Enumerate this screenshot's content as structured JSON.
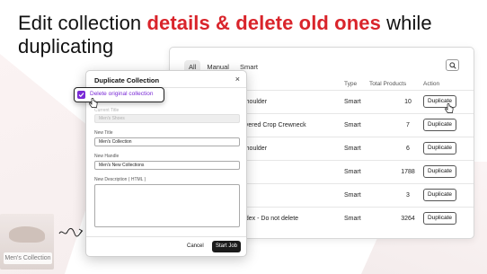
{
  "headline": {
    "prefix": "Edit collection ",
    "accent": "details & delete old ones",
    "suffix": " while duplicating"
  },
  "thumbnail": {
    "caption": "Men's Collection"
  },
  "panel": {
    "tabs": [
      "All",
      "Manual",
      "Smart"
    ],
    "columns": {
      "type": "Type",
      "total": "Total Products",
      "action": "Action"
    },
    "rows": [
      {
        "title": "Shoulder",
        "type": "Smart",
        "total": "10",
        "action": "Duplicate"
      },
      {
        "title": "ayered Crop Crewneck",
        "type": "Smart",
        "total": "7",
        "action": "Duplicate"
      },
      {
        "title": "Shoulder",
        "type": "Smart",
        "total": "6",
        "action": "Duplicate"
      },
      {
        "title": "",
        "type": "Smart",
        "total": "1788",
        "action": "Duplicate"
      },
      {
        "title": "",
        "type": "Smart",
        "total": "3",
        "action": "Duplicate"
      },
      {
        "title": "ndex - Do not delete",
        "type": "Smart",
        "total": "3264",
        "action": "Duplicate"
      }
    ]
  },
  "dialog": {
    "title": "Duplicate Collection",
    "close": "×",
    "checkbox_label": "Delete original collection",
    "checkbox_checked": true,
    "current_title_label": "Current Title",
    "current_title_value": "Men's Shoes",
    "new_title_label": "New Title",
    "new_title_value": "Men's Collection",
    "new_handle_label": "New Handle",
    "new_handle_value": "Men's New Collections",
    "description_label": "New Description ( HTML )",
    "cancel_label": "Cancel",
    "start_label": "Start Job"
  },
  "colors": {
    "accent": "#d9242b",
    "checkbox": "#7a2ad6",
    "primary_button": "#1b1b1b"
  }
}
